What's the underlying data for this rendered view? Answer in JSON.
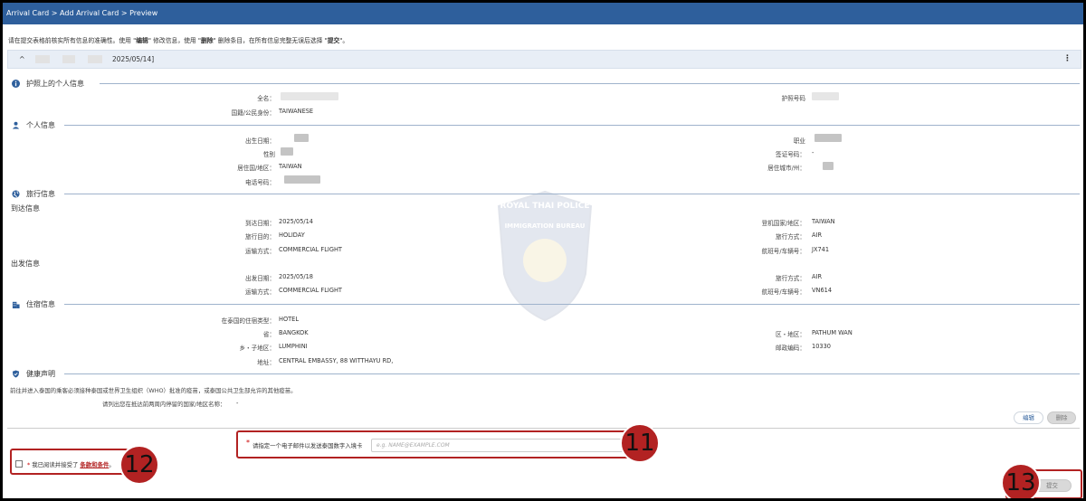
{
  "breadcrumb": [
    "Arrival Card",
    "Add Arrival Card",
    "Preview"
  ],
  "breadcrumb_sep": " > ",
  "instructions": {
    "pre": "请在提交表格前核实所有信息的准确性。使用 \"",
    "edit": "编辑",
    "mid1": "\" 修改信息，使用 \"",
    "delete": "删除",
    "mid2": "\" 删除条目，在所有信息完整无误后选择 \"",
    "submit": "提交",
    "post": "\"。"
  },
  "card_header": {
    "caret": "^",
    "date": "2025/05/14]",
    "menu": "⋮"
  },
  "sections": {
    "passport": {
      "title": "护照上的个人信息",
      "icon": "info-icon"
    },
    "personal": {
      "title": "个人信息",
      "icon": "person-icon"
    },
    "travel": {
      "title": "旅行信息",
      "icon": "globe-icon"
    },
    "accommodation": {
      "title": "住宿信息",
      "icon": "building-icon"
    },
    "health": {
      "title": "健康声明",
      "icon": "shield-icon"
    }
  },
  "passport": {
    "full_name_label": "全名：",
    "passport_no_label": "护照号码",
    "nationality_label": "国籍/公民身份：",
    "nationality": "TAIWANESE"
  },
  "personal": {
    "dob_label": "出生日期：",
    "occupation_label": "职业",
    "gender_label": "性别",
    "visa_label": "签证号码：",
    "visa_value": "-",
    "country_label": "居住国/地区：",
    "country": "TAIWAN",
    "city_label": "居住城市/州：",
    "phone_label": "电话号码："
  },
  "arrival": {
    "heading": "到达信息",
    "date_label": "到达日期：",
    "date": "2025/05/14",
    "boarding_label": "登机国家/地区：",
    "boarding": "TAIWAN",
    "purpose_label": "旅行目的：",
    "purpose": "HOLIDAY",
    "travel_mode_label": "旅行方式：",
    "travel_mode": "AIR",
    "transport_label": "运输方式：",
    "transport": "COMMERCIAL FLIGHT",
    "flight_label": "航班号/车辆号：",
    "flight": "JX741"
  },
  "departure": {
    "heading": "出发信息",
    "date_label": "出发日期：",
    "date": "2025/05/18",
    "travel_mode_label": "旅行方式：",
    "travel_mode": "AIR",
    "transport_label": "运输方式：",
    "transport": "COMMERCIAL FLIGHT",
    "flight_label": "航班号/车辆号：",
    "flight": "VN614"
  },
  "accommodation": {
    "type_label": "在泰国的住宿类型：",
    "type": "HOTEL",
    "province_label": "省：",
    "province": "BANGKOK",
    "district_label": "区・地区：",
    "district": "PATHUM WAN",
    "subdistrict_label": "乡・子地区：",
    "subdistrict": "LUMPHINI",
    "postcode_label": "邮政编码：",
    "postcode": "10330",
    "address_label": "地址：",
    "address": "CENTRAL EMBASSY, 88 WITTHAYU RD,"
  },
  "health": {
    "notice": "前往并进入泰国的乘客必须接种泰国或世界卫生组织（WHO）批准的疫苗，或泰国公共卫生部允许的其他疫苗。",
    "countries_label": "请列出您在抵达前两周内停留的国家/地区名称：",
    "countries_value": "-"
  },
  "buttons": {
    "edit": "编辑",
    "delete": "删除",
    "submit": "提交"
  },
  "email": {
    "star": "*",
    "label": "请指定一个电子邮件以发送泰国数字入境卡",
    "placeholder": "e.g. NAME@EXAMPLE.COM"
  },
  "terms": {
    "star": "*",
    "text": "我已阅读并接受了",
    "link": "条款和条件",
    "end": "。"
  },
  "watermark": {
    "top_text": "ROYAL THAI POLICE",
    "bottom_text": "IMMIGRATION BUREAU"
  },
  "badges": {
    "email": "11",
    "terms": "12",
    "submit": "13"
  },
  "colors": {
    "topbar": "#2e5f9c",
    "highlight": "#b22222"
  }
}
